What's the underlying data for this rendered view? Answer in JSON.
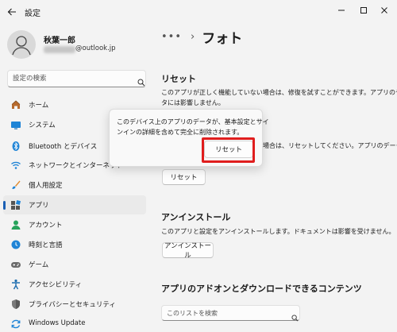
{
  "window": {
    "title": "設定",
    "icons": [
      "back-arrow-icon",
      "minimize-icon",
      "maximize-icon",
      "close-icon"
    ]
  },
  "user": {
    "name": "秋葉一郎",
    "email_domain": "@outlook.jp"
  },
  "sidebar": {
    "search_placeholder": "設定の検索",
    "items": [
      {
        "label": "ホーム",
        "icon": "home-icon",
        "selected": false
      },
      {
        "label": "システム",
        "icon": "system-icon",
        "selected": false
      },
      {
        "label": "Bluetooth とデバイス",
        "icon": "bluetooth-icon",
        "selected": false
      },
      {
        "label": "ネットワークとインターネット",
        "icon": "wifi-icon",
        "selected": false
      },
      {
        "label": "個人用設定",
        "icon": "brush-icon",
        "selected": false
      },
      {
        "label": "アプリ",
        "icon": "apps-icon",
        "selected": true
      },
      {
        "label": "アカウント",
        "icon": "account-icon",
        "selected": false
      },
      {
        "label": "時刻と言語",
        "icon": "globe-clock-icon",
        "selected": false
      },
      {
        "label": "ゲーム",
        "icon": "gamepad-icon",
        "selected": false
      },
      {
        "label": "アクセシビリティ",
        "icon": "accessibility-icon",
        "selected": false
      },
      {
        "label": "プライバシーとセキュリティ",
        "icon": "shield-icon",
        "selected": false
      },
      {
        "label": "Windows Update",
        "icon": "update-icon",
        "selected": false
      }
    ]
  },
  "breadcrumb": {
    "dots": "•••",
    "separator": "›",
    "title": "フォト"
  },
  "main": {
    "reset": {
      "title": "リセット",
      "repair_line1": "このアプリが正しく機能していない場合は、修復を試すことができます。アプリのデー",
      "repair_line2": "タには影響しません。",
      "reset_line_tail": "場合は、リセットしてください。アプリのデータは",
      "reset_button": "リセット"
    },
    "uninstall": {
      "title": "アンインストール",
      "desc": "このアプリと設定をアンインストールします。ドキュメントは影響を受けません。",
      "button": "アンインストール"
    },
    "addons": {
      "title": "アプリのアドオンとダウンロードできるコンテンツ",
      "search_placeholder": "このリストを検索"
    }
  },
  "flyout": {
    "line1": "このデバイス上のアプリのデータが、基本設定とサイ",
    "line2": "ンインの詳細を含めて完全に削除されます。",
    "button": "リセット"
  },
  "colors": {
    "accent": "#1a5fb4",
    "highlight": "#e01e1e"
  }
}
